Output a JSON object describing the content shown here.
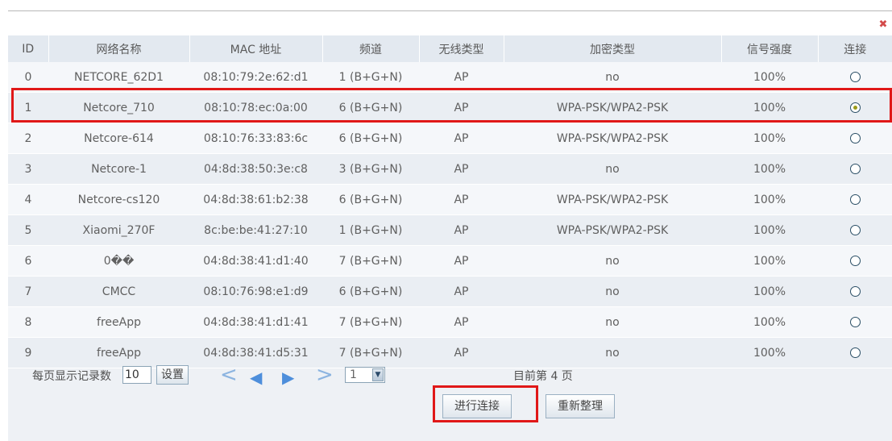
{
  "close_icon_glyph": "✖",
  "table": {
    "headers": [
      "ID",
      "网络名称",
      "MAC 地址",
      "频道",
      "无线类型",
      "加密类型",
      "信号强度",
      "连接"
    ],
    "rows": [
      {
        "id": "0",
        "name": "NETCORE_62D1",
        "mac": "08:10:79:2e:62:d1",
        "channel": "1 (B+G+N)",
        "type": "AP",
        "enc": "no",
        "signal": "100%",
        "selected": false
      },
      {
        "id": "1",
        "name": "Netcore_710",
        "mac": "08:10:78:ec:0a:00",
        "channel": "6 (B+G+N)",
        "type": "AP",
        "enc": "WPA-PSK/WPA2-PSK",
        "signal": "100%",
        "selected": true
      },
      {
        "id": "2",
        "name": "Netcore-614",
        "mac": "08:10:76:33:83:6c",
        "channel": "6 (B+G+N)",
        "type": "AP",
        "enc": "WPA-PSK/WPA2-PSK",
        "signal": "100%",
        "selected": false
      },
      {
        "id": "3",
        "name": "Netcore-1",
        "mac": "04:8d:38:50:3e:c8",
        "channel": "3 (B+G+N)",
        "type": "AP",
        "enc": "no",
        "signal": "100%",
        "selected": false
      },
      {
        "id": "4",
        "name": "Netcore-cs120",
        "mac": "04:8d:38:61:b2:38",
        "channel": "6 (B+G+N)",
        "type": "AP",
        "enc": "WPA-PSK/WPA2-PSK",
        "signal": "100%",
        "selected": false
      },
      {
        "id": "5",
        "name": "Xiaomi_270F",
        "mac": "8c:be:be:41:27:10",
        "channel": "1 (B+G+N)",
        "type": "AP",
        "enc": "WPA-PSK/WPA2-PSK",
        "signal": "100%",
        "selected": false
      },
      {
        "id": "6",
        "name": "0��",
        "mac": "04:8d:38:41:d1:40",
        "channel": "7 (B+G+N)",
        "type": "AP",
        "enc": "no",
        "signal": "100%",
        "selected": false
      },
      {
        "id": "7",
        "name": "CMCC",
        "mac": "08:10:76:98:e1:d9",
        "channel": "6 (B+G+N)",
        "type": "AP",
        "enc": "no",
        "signal": "100%",
        "selected": false
      },
      {
        "id": "8",
        "name": "freeApp",
        "mac": "04:8d:38:41:d1:41",
        "channel": "7 (B+G+N)",
        "type": "AP",
        "enc": "no",
        "signal": "100%",
        "selected": false
      },
      {
        "id": "9",
        "name": "freeApp",
        "mac": "04:8d:38:41:d5:31",
        "channel": "7 (B+G+N)",
        "type": "AP",
        "enc": "no",
        "signal": "100%",
        "selected": false
      }
    ]
  },
  "pager": {
    "per_page_label": "每页显示记录数",
    "per_page_value": "10",
    "set_label": "设置",
    "first_glyph": "<",
    "prev_glyph": "◀",
    "next_glyph": "▶",
    "last_glyph": ">",
    "page_select_value": "1",
    "page_select_arrow": "▼",
    "page_info": "目前第 4 页"
  },
  "actions": {
    "connect_label": "进行连接",
    "refresh_label": "重新整理"
  },
  "colors": {
    "highlight": "#e01818",
    "link_blue": "#4d8edb"
  }
}
